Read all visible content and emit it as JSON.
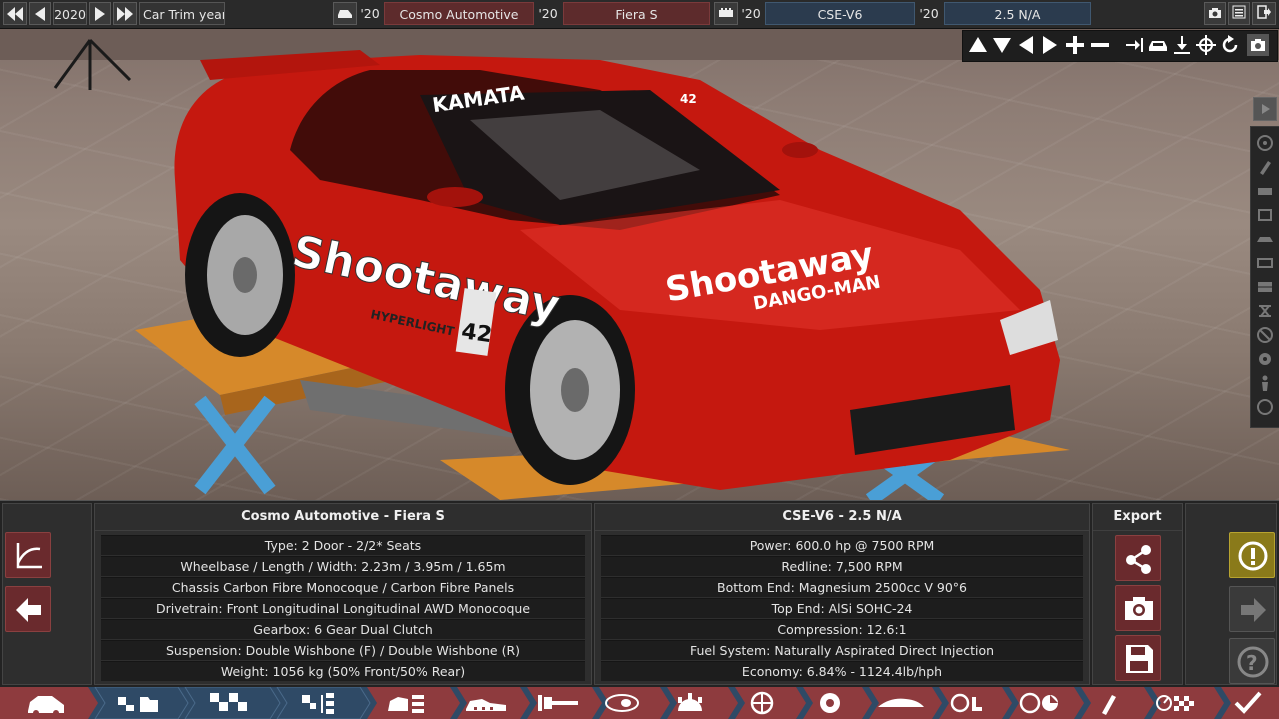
{
  "topbar": {
    "year": "2020",
    "car_trim_year_label": "Car Trim year",
    "model_year": "'20",
    "model_name": "Cosmo Automotive",
    "trim_year": "'20",
    "trim_name": "Fiera S",
    "engine_family_year": "'20",
    "engine_family": "CSE-V6",
    "engine_variant_year": "'20",
    "engine_variant": "2.5 N/A"
  },
  "viewport": {
    "windshield_banner": "KAMATA",
    "windshield_number": "42",
    "door_decal": "Shootaway",
    "door_sub": "HYPERLIGHT",
    "door_plate": "42",
    "hood_decal": "Shootaway",
    "hood_sub": "DANGO-MAN"
  },
  "car_panel": {
    "title": "Cosmo Automotive - Fiera S",
    "rows": [
      "Type: 2 Door - 2/2* Seats",
      "Wheelbase / Length / Width: 2.23m / 3.95m / 1.65m",
      "Chassis Carbon Fibre Monocoque / Carbon Fibre Panels",
      "Drivetrain: Front Longitudinal Longitudinal AWD Monocoque",
      "Gearbox: 6 Gear Dual Clutch",
      "Suspension: Double Wishbone (F) / Double Wishbone (R)",
      "Weight: 1056 kg (50% Front/50% Rear)"
    ]
  },
  "engine_panel": {
    "title": "CSE-V6 - 2.5 N/A",
    "rows": [
      "Power: 600.0 hp @ 7500 RPM",
      "Redline:  7,500 RPM",
      "Bottom End: Magnesium 2500cc V 90°6",
      "Top End: AlSi SOHC-24",
      "Compression: 12.6:1",
      "Fuel System: Naturally Aspirated Direct Injection",
      "Economy: 6.84% - 1124.4lb/hph"
    ]
  },
  "export_panel": {
    "title": "Export"
  },
  "colors": {
    "maroon": "#6a2a2d",
    "blue_nav": "#2f4a66",
    "active_nav": "#8e3b3e",
    "warning": "#8a7a1a"
  }
}
